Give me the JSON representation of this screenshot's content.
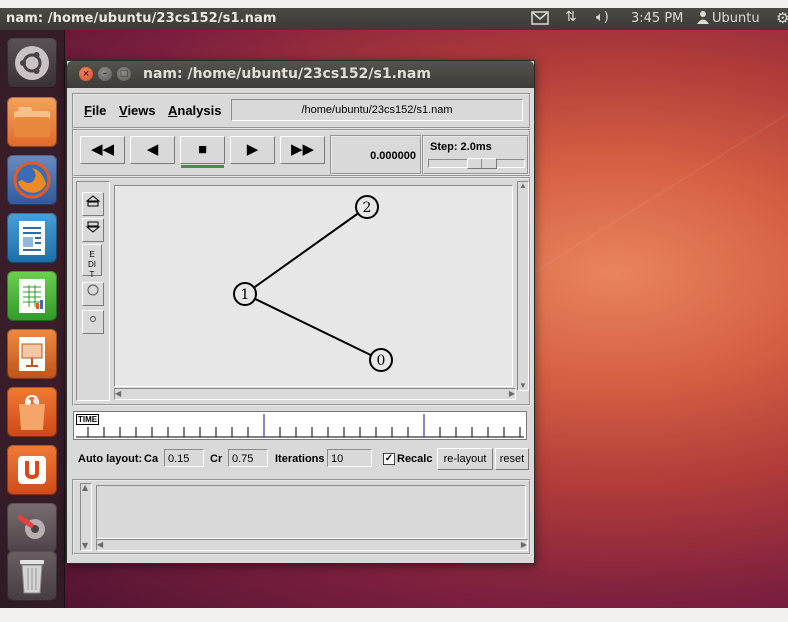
{
  "top_panel": {
    "title": "nam: /home/ubuntu/23cs152/s1.nam",
    "clock": "3:45 PM",
    "user": "Ubuntu",
    "icons": [
      "mail-icon",
      "network-icon",
      "volume-icon",
      "user-icon",
      "gear-icon"
    ]
  },
  "launcher": {
    "items": [
      "dash-home",
      "files",
      "firefox",
      "libreoffice-writer",
      "libreoffice-calc",
      "libreoffice-impress",
      "ubuntu-software-center",
      "ubuntu-one",
      "system-settings",
      "trash"
    ]
  },
  "window": {
    "title": "nam: /home/ubuntu/23cs152/s1.nam"
  },
  "menu": {
    "file": "File",
    "views": "Views",
    "analysis": "Analysis",
    "path": "/home/ubuntu/23cs152/s1.nam"
  },
  "controls": {
    "rewind": "◀◀",
    "back": "◀",
    "stop": "■",
    "play": "▶",
    "fast_forward": "▶▶",
    "time": "0.000000",
    "step": "Step: 2.0ms"
  },
  "tools": {
    "edit": "EDIT"
  },
  "topology": {
    "nodes": [
      {
        "id": "0",
        "label": "0"
      },
      {
        "id": "1",
        "label": "1"
      },
      {
        "id": "2",
        "label": "2"
      }
    ],
    "links": [
      {
        "from": "1",
        "to": "2"
      },
      {
        "from": "1",
        "to": "0"
      }
    ]
  },
  "timeline": {
    "tag": "TIME"
  },
  "layout": {
    "auto_layout": "Auto layout:",
    "ca_label": "Ca",
    "ca_value": "0.15",
    "cr_label": "Cr",
    "cr_value": "0.75",
    "iterations_label": "Iterations",
    "iterations_value": "10",
    "recalc_label": "Recalc",
    "recalc_checked": true,
    "relayout": "re-layout",
    "reset": "reset"
  }
}
